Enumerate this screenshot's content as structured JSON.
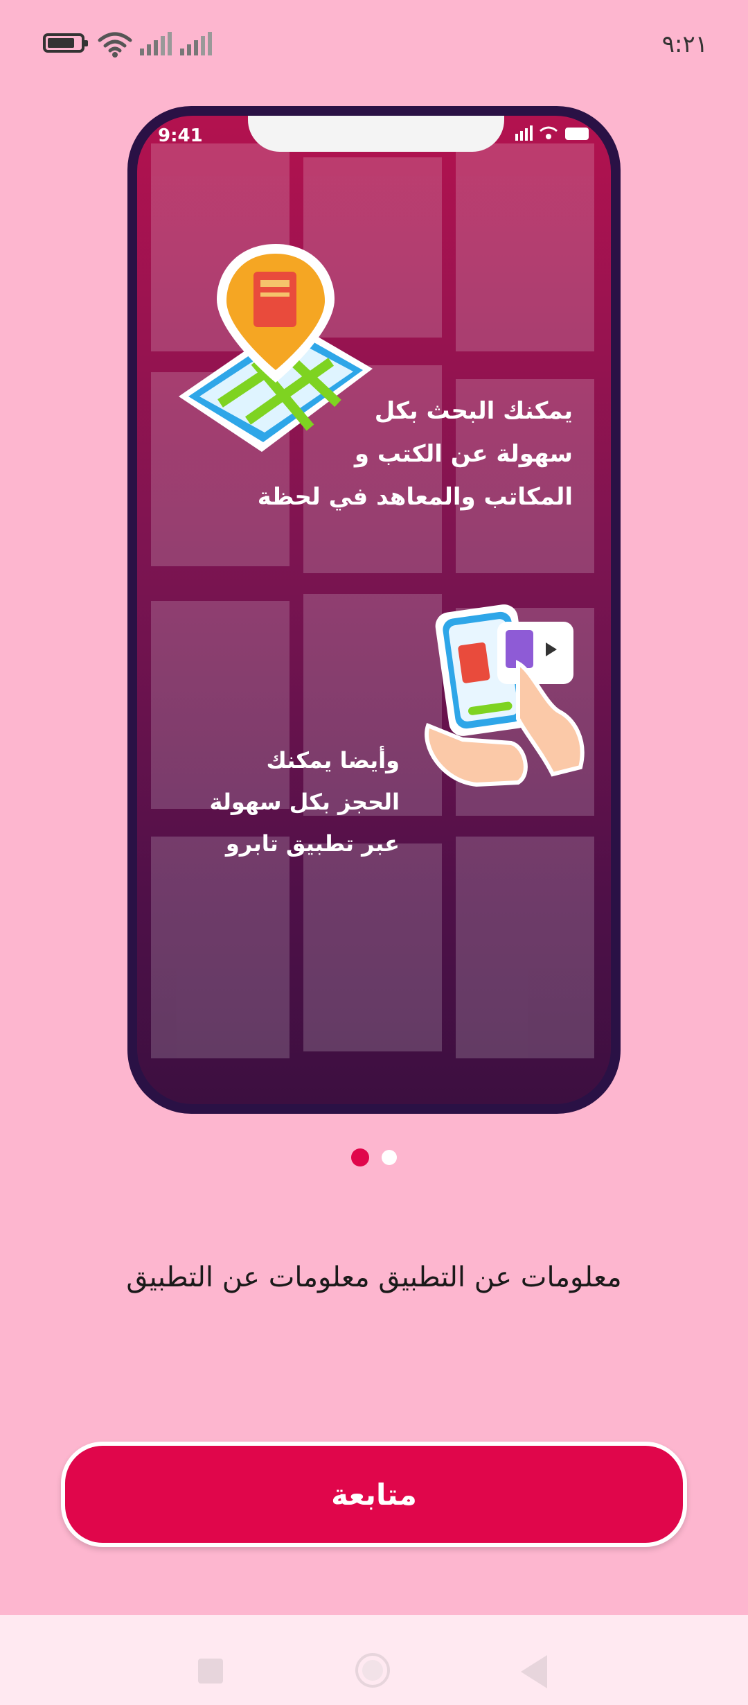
{
  "status_bar": {
    "time": "٩:٢١"
  },
  "mockup": {
    "time": "9:41",
    "headline_1": [
      "يمكنك البحث بكل",
      "سهولة عن الكتب و",
      "المكاتب والمعاهد في لحظة"
    ],
    "headline_2": [
      "وأيضا يمكنك",
      "الحجز بكل سهولة",
      "عبر تطبيق تابرو"
    ]
  },
  "pagination": {
    "count": 2,
    "active_index": 0
  },
  "info_text": "معلومات عن التطبيق  معلومات عن التطبيق",
  "continue_label": "متابعة",
  "colors": {
    "background": "#fdb6cf",
    "accent": "#e0064b",
    "nav_bar": "#ffe9f1"
  },
  "icons": [
    "battery-icon",
    "wifi-icon",
    "signal-icon",
    "map-pin-book-icon",
    "hand-phone-book-icon",
    "nav-recents-icon",
    "nav-home-icon",
    "nav-back-icon"
  ]
}
